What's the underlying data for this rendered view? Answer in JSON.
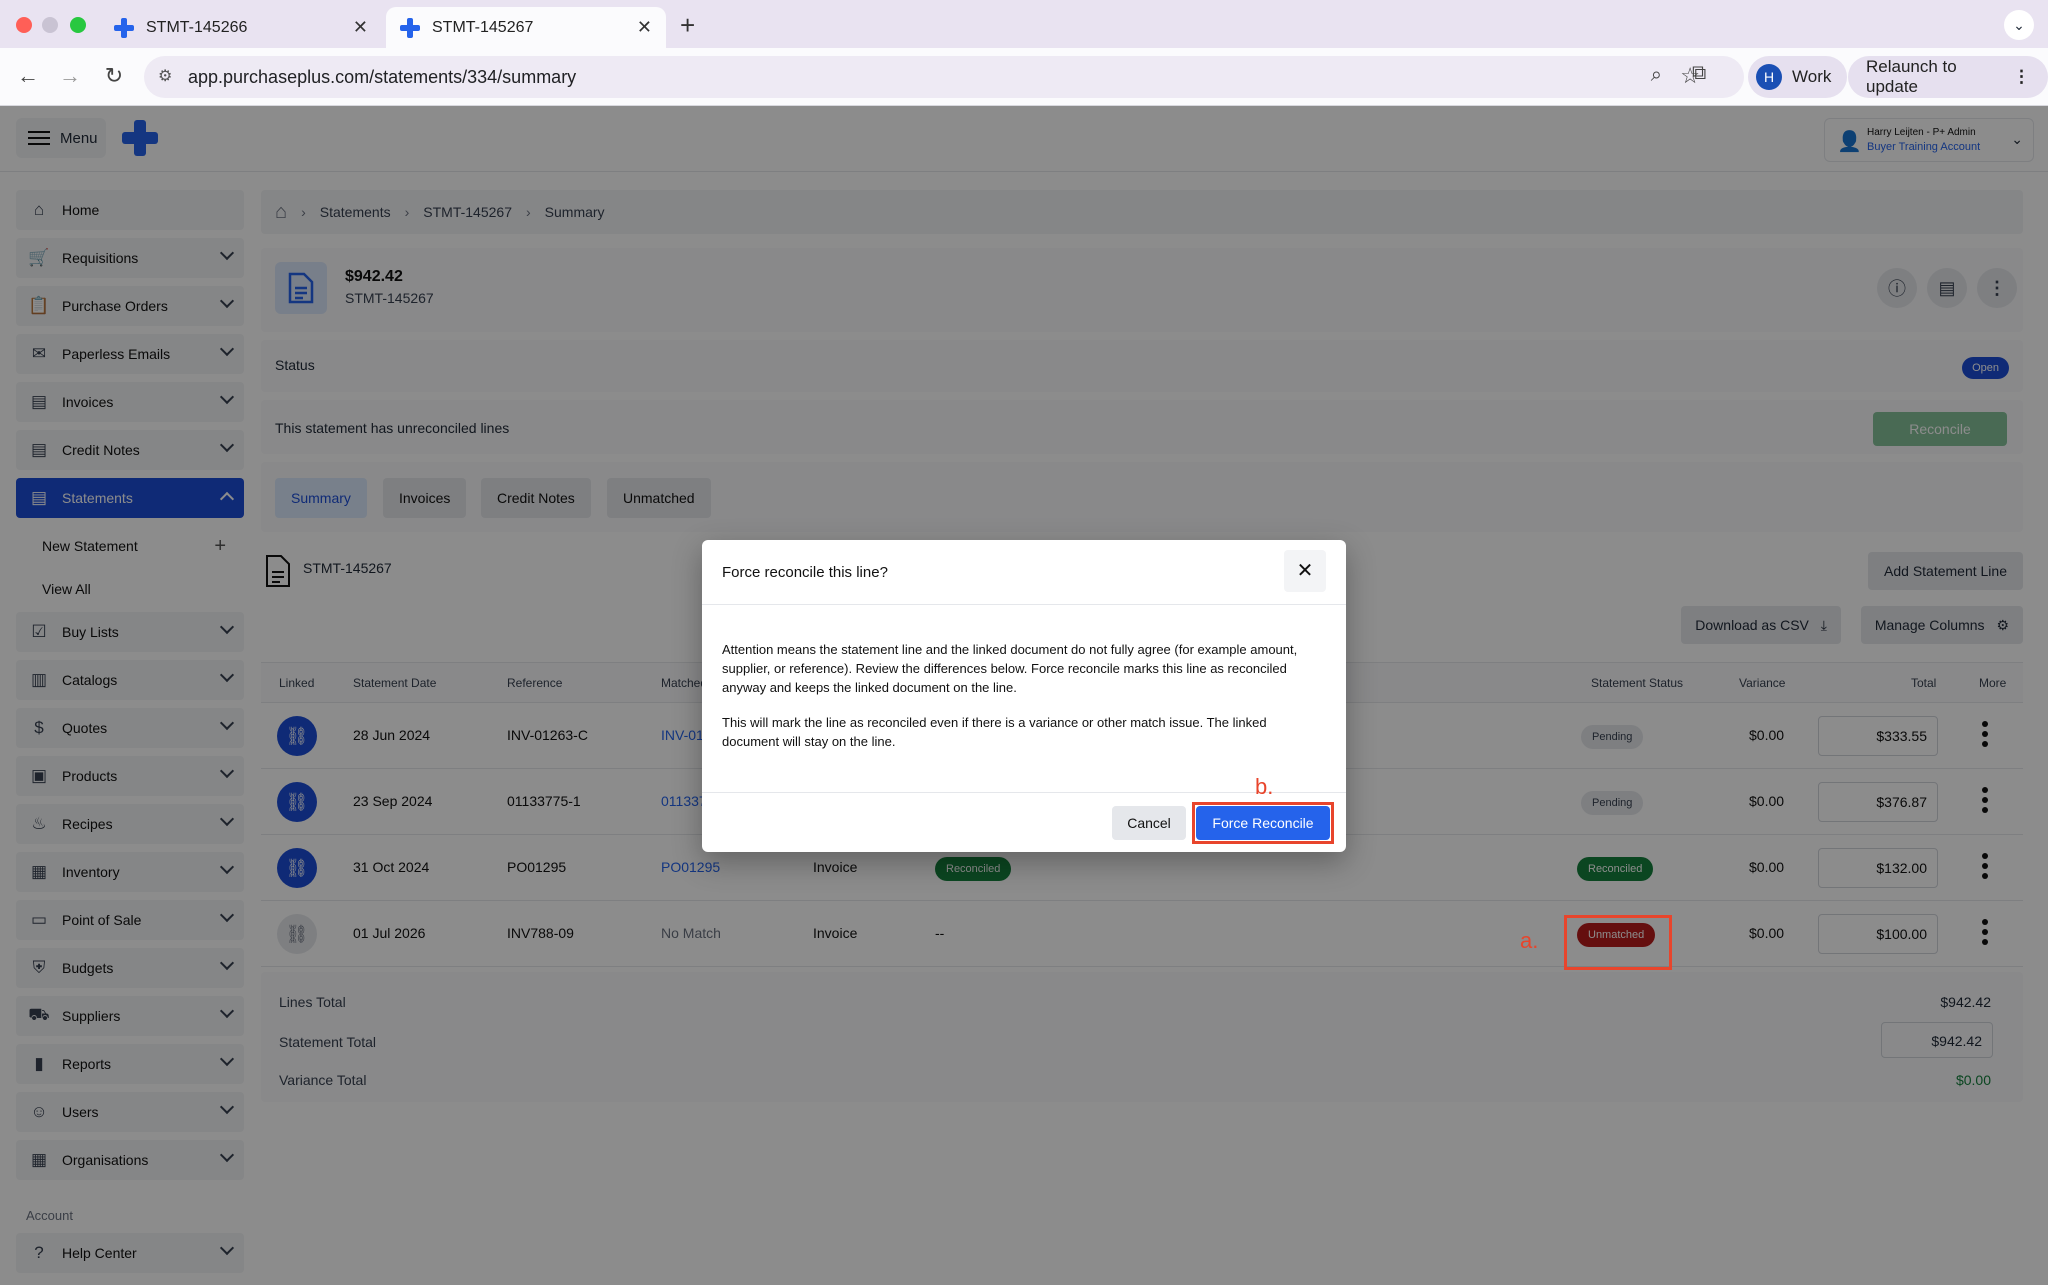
{
  "browser": {
    "tabs": [
      {
        "title": "STMT-145266"
      },
      {
        "title": "STMT-145267"
      }
    ],
    "url": "app.purchaseplus.com/statements/334/summary",
    "profile_initial": "H",
    "profile_label": "Work",
    "relaunch_label": "Relaunch to update"
  },
  "header": {
    "menu_label": "Menu",
    "user_name": "Harry Leijten - P+ Admin",
    "account": "Buyer Training Account"
  },
  "sidebar": {
    "items": [
      {
        "label": "Home",
        "icon": "home-icon"
      },
      {
        "label": "Requisitions",
        "icon": "cart-icon"
      },
      {
        "label": "Purchase Orders",
        "icon": "clipboard-icon"
      },
      {
        "label": "Paperless Emails",
        "icon": "mail-icon"
      },
      {
        "label": "Invoices",
        "icon": "document-icon"
      },
      {
        "label": "Credit Notes",
        "icon": "document-icon"
      },
      {
        "label": "Statements",
        "icon": "document-icon"
      }
    ],
    "sub_items": [
      {
        "label": "New Statement"
      },
      {
        "label": "View All"
      }
    ],
    "items2": [
      {
        "label": "Buy Lists"
      },
      {
        "label": "Catalogs"
      },
      {
        "label": "Quotes"
      },
      {
        "label": "Products"
      },
      {
        "label": "Recipes"
      },
      {
        "label": "Inventory"
      },
      {
        "label": "Point of Sale"
      },
      {
        "label": "Budgets"
      },
      {
        "label": "Suppliers"
      },
      {
        "label": "Reports"
      },
      {
        "label": "Users"
      },
      {
        "label": "Organisations"
      }
    ],
    "account_heading": "Account",
    "help_label": "Help Center"
  },
  "breadcrumb": [
    "Statements",
    "STMT-145267",
    "Summary"
  ],
  "statement": {
    "amount": "$942.42",
    "id": "STMT-145267",
    "status_label": "Status",
    "status_value": "Open",
    "unreconciled_text": "This statement has unreconciled lines",
    "reconcile_label": "Reconcile"
  },
  "tabs": [
    "Summary",
    "Invoices",
    "Credit Notes",
    "Unmatched"
  ],
  "table": {
    "title": "STMT-145267",
    "add_line_label": "Add Statement Line",
    "download_label": "Download as CSV",
    "manage_columns_label": "Manage Columns",
    "columns": [
      "Linked",
      "Statement Date",
      "Reference",
      "Matched",
      "Statement Status",
      "Variance",
      "Total",
      "More"
    ],
    "rows": [
      {
        "date": "28 Jun 2024",
        "reference": "INV-01263-C",
        "matched": "INV-01",
        "type": "",
        "doc_status": "",
        "status": "Pending",
        "variance": "$0.00",
        "total": "$333.55"
      },
      {
        "date": "23 Sep 2024",
        "reference": "01133775-1",
        "matched": "011337",
        "type": "",
        "doc_status": "",
        "status": "Pending",
        "variance": "$0.00",
        "total": "$376.87"
      },
      {
        "date": "31 Oct 2024",
        "reference": "PO01295",
        "matched": "PO01295",
        "type": "Invoice",
        "doc_status": "Reconciled",
        "status": "Reconciled",
        "variance": "$0.00",
        "total": "$132.00"
      },
      {
        "date": "01 Jul 2026",
        "reference": "INV788-09",
        "matched": "No Match",
        "type": "Invoice",
        "doc_status": "--",
        "status": "Unmatched",
        "variance": "$0.00",
        "total": "$100.00"
      }
    ]
  },
  "totals": {
    "lines_label": "Lines Total",
    "lines_value": "$942.42",
    "statement_label": "Statement Total",
    "statement_value": "$942.42",
    "variance_label": "Variance Total",
    "variance_value": "$0.00"
  },
  "modal": {
    "title": "Force reconcile this line?",
    "para1": "Attention means the statement line and the linked document do not fully agree (for example amount, supplier, or reference). Review the differences below. Force reconcile marks this line as reconciled anyway and keeps the linked document on the line.",
    "para2": "This will mark the line as reconciled even if there is a variance or other match issue. The linked document will stay on the line.",
    "cancel_label": "Cancel",
    "confirm_label": "Force Reconcile"
  },
  "annotations": {
    "a": "a.",
    "b": "b."
  },
  "colors": {
    "primary": "#2563eb",
    "success": "#15803d",
    "danger": "#b91c1c",
    "annotation": "#e8452c"
  }
}
